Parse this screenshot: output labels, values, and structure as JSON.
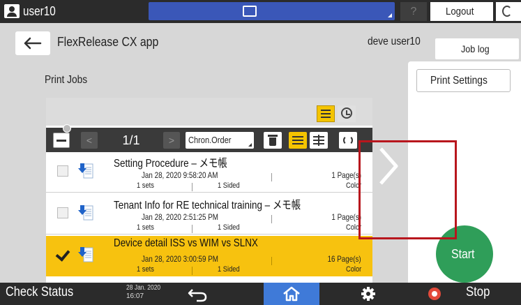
{
  "topbar": {
    "username": "user10",
    "help_label": "?",
    "logout_label": "Logout"
  },
  "header": {
    "title": "FlexRelease CX app",
    "user_label": "deve user10",
    "joblog_label": "Job log"
  },
  "section_title": "Print Jobs",
  "toolbar": {
    "prev_label": "<",
    "page_indicator": "1/1",
    "next_label": ">",
    "sort_value": "Chron.Order"
  },
  "jobs": [
    {
      "name": "Setting Procedure – メモ帳",
      "date": "Jan 28, 2020 9:58:20 AM",
      "sets": "1 sets",
      "sided": "1 Sided",
      "pages": "1 Page(s)",
      "color": "Color",
      "selected": false
    },
    {
      "name": "Tenant Info for RE technical training – メモ帳",
      "date": "Jan 28, 2020 2:51:25 PM",
      "sets": "1 sets",
      "sided": "1 Sided",
      "pages": "1 Page(s)",
      "color": "Color",
      "selected": false
    },
    {
      "name": "Device detail ISS vs WIM vs SLNX",
      "date": "Jan 28, 2020 3:00:59 PM",
      "sets": "1 sets",
      "sided": "1 Sided",
      "pages": "16 Page(s)",
      "color": "Color",
      "selected": true
    }
  ],
  "right_panel": {
    "print_settings_label": "Print Settings",
    "start_label": "Start"
  },
  "bottombar": {
    "check_status_label": "Check Status",
    "clock_date": "28 Jan. 2020",
    "clock_time": "16:07",
    "stop_label": "Stop"
  },
  "colors": {
    "accent_yellow": "#f7c20f",
    "start_green": "#2f9e59",
    "home_blue": "#3f7ad8",
    "highlight_red": "#b8161d"
  }
}
